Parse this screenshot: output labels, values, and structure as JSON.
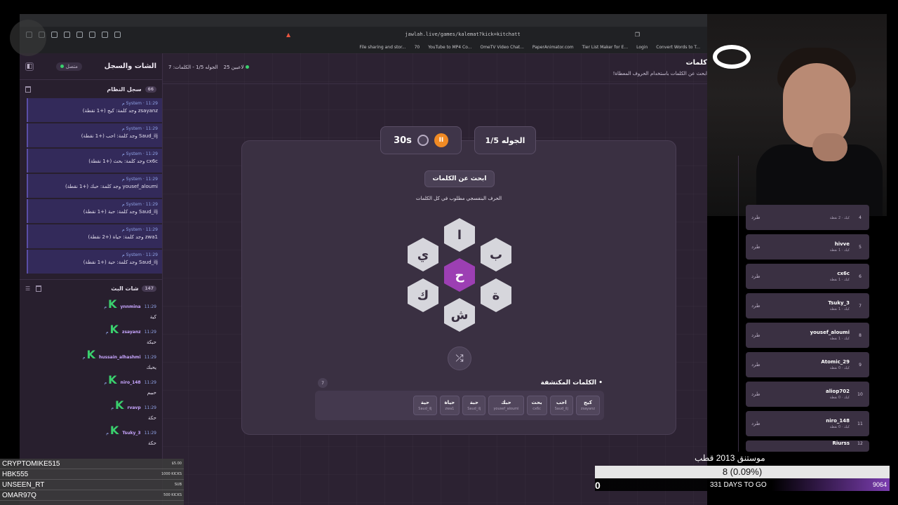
{
  "browser": {
    "url": "jawlah.live/games/kalemat?kick=kitchatt",
    "bookmarks": [
      "File sharing and stor...",
      "70",
      "YouTube to MP4 Co...",
      "OmeTV Video Chat...",
      "PaperAnimator.com",
      "Tier List Maker for E...",
      "Login",
      "Convert Words to T..."
    ]
  },
  "sidebar": {
    "title": "الشات والسجل",
    "status": "متصل",
    "system_log": {
      "title": "سجل النظام",
      "count": "66",
      "messages": [
        {
          "sender": "System",
          "time": "11:29 م",
          "text": "zsayanz وجد كلمة: كيج (+1 نقطة)"
        },
        {
          "sender": "System",
          "time": "11:29 م",
          "text": "Saud_ilj وجد كلمة: احب (+1 نقطة)"
        },
        {
          "sender": "System",
          "time": "11:29 م",
          "text": "cx6c وجد كلمة: بحث (+1 نقطة)"
        },
        {
          "sender": "System",
          "time": "11:29 م",
          "text": "yousef_aloumi وجد كلمة: حبك (+1 نقطة)"
        },
        {
          "sender": "System",
          "time": "11:29 م",
          "text": "Saud_ilj وجد كلمة: حبة (+1 نقطة)"
        },
        {
          "sender": "System",
          "time": "11:29 م",
          "text": "zwa1 وجد كلمة: حياة (+2 نقطة)"
        },
        {
          "sender": "System",
          "time": "11:29 م",
          "text": "Saud_ilj وجد كلمة: حية (+1 نقطة)"
        }
      ]
    },
    "stream_chat": {
      "title": "شات البث",
      "count": "147",
      "messages": [
        {
          "user": "ynnmina",
          "time": "11:29 م",
          "text": "كية"
        },
        {
          "user": "zsayanz",
          "time": "11:29 م",
          "text": "حبكة"
        },
        {
          "user": "hussain_alhashmi",
          "time": "11:29 م",
          "text": "يحبك"
        },
        {
          "user": "niro_148",
          "time": "11:29 م",
          "text": "حبيم"
        },
        {
          "user": "rvavp",
          "time": "11:29 م",
          "text": "حكة"
        },
        {
          "user": "Tsuky_3",
          "time": "11:29 م",
          "text": "حكة"
        }
      ]
    }
  },
  "top": {
    "players": "25 لاعبين",
    "round_info": "الجوله 1/5 - الكلمات: 7",
    "heading": "كلمات",
    "subtitle": "ابحث عن الكلمات باستخدام الحروف المعطاة!"
  },
  "game": {
    "timer": "30s",
    "round": "الجوله 1/5",
    "find_label": "ابحث عن الكلمات",
    "hint": "الحرف البنفسجي مطلوب في كل الكلمات",
    "center_letter": "ح",
    "letters": {
      "top": "ا",
      "top_right": "ب",
      "bottom_right": "ة",
      "bottom": "ش",
      "bottom_left": "ك",
      "top_left": "ي"
    },
    "found_title": "الكلمات المكتشفة",
    "found_count": "7",
    "found_words": [
      {
        "word": "كيج",
        "user": "zsayanz"
      },
      {
        "word": "احب",
        "user": "Saud_ilj"
      },
      {
        "word": "بحث",
        "user": "cx6c"
      },
      {
        "word": "حبك",
        "user": "yousef_aloumi"
      },
      {
        "word": "حبة",
        "user": "Saud_ilj"
      },
      {
        "word": "حياة",
        "user": "zwa1"
      },
      {
        "word": "حية",
        "user": "Saud_ilj"
      }
    ]
  },
  "leaderboard": {
    "kick_label": "طرد",
    "rows": [
      {
        "rank": "4",
        "name": "",
        "pts": "كيك · 2 نقطة"
      },
      {
        "rank": "5",
        "name": "hivve",
        "pts": "كيك · 1 نقطة"
      },
      {
        "rank": "6",
        "name": "cx6c",
        "pts": "كيك · 1 نقطة"
      },
      {
        "rank": "7",
        "name": "Tsuky_3",
        "pts": "كيك · 1 نقطة"
      },
      {
        "rank": "8",
        "name": "yousef_aloumi",
        "pts": "كيك · 1 نقطة"
      },
      {
        "rank": "9",
        "name": "Atomic_29",
        "pts": "كيك · 0 نقطة"
      },
      {
        "rank": "10",
        "name": "aliop702",
        "pts": "كيك · 0 نقطة"
      },
      {
        "rank": "11",
        "name": "niro_148",
        "pts": "كيك · 0 نقطة"
      },
      {
        "rank": "12",
        "name": "Riurss",
        "pts": ""
      }
    ]
  },
  "donations": [
    {
      "name": "CRYPTOMIKE515",
      "amount": "$5.00"
    },
    {
      "name": "HBK555",
      "amount": "1000 KICKS"
    },
    {
      "name": "UNSEEN_RT",
      "amount": "SUB"
    },
    {
      "name": "OMAR97Q",
      "amount": "500 KICKS"
    }
  ],
  "goal": {
    "title": "موستنق 2013 قطب",
    "progress_text": "8 (0.09%)",
    "progress_fraction": 0.0009,
    "start": "0",
    "days": "331 DAYS TO GO",
    "end": "9064"
  },
  "colors": {
    "accent": "#9c3fb3",
    "kick_green": "#3ad06e",
    "timer_orange": "#f08a24"
  }
}
